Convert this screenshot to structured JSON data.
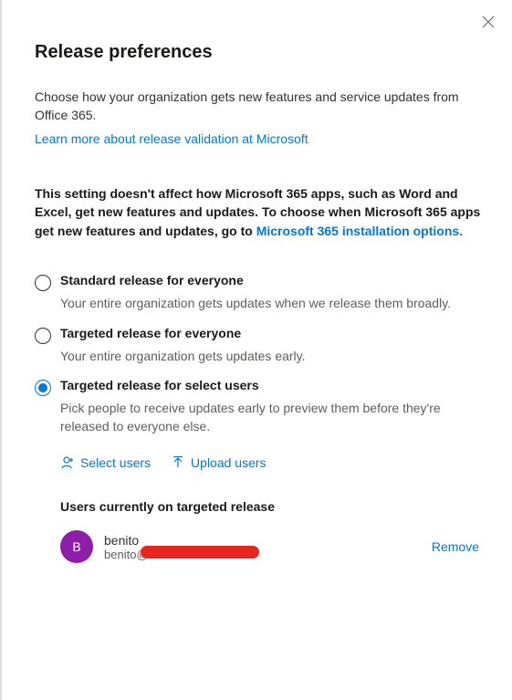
{
  "header": {
    "title": "Release preferences"
  },
  "intro": {
    "text": "Choose how your organization gets new features and service updates from Office 365.",
    "learn_more": "Learn more about release validation at Microsoft"
  },
  "notice": {
    "prefix": "This setting doesn't affect how Microsoft 365 apps, such as Word and Excel, get new features and updates. To choose when Microsoft 365 apps get new features and updates, go to ",
    "link": "Microsoft 365 installation options."
  },
  "options": [
    {
      "label": "Standard release for everyone",
      "desc": "Your entire organization gets updates when we release them broadly.",
      "selected": false
    },
    {
      "label": "Targeted release for everyone",
      "desc": "Your entire organization gets updates early.",
      "selected": false
    },
    {
      "label": "Targeted release for select users",
      "desc": "Pick people to receive updates early to preview them before they're released to everyone else.",
      "selected": true
    }
  ],
  "actions": {
    "select_users": "Select users",
    "upload_users": "Upload users"
  },
  "users_section": {
    "heading": "Users currently on targeted release",
    "users": [
      {
        "initial": "B",
        "name": "benito",
        "email": "benito@",
        "avatar_color": "#8e1da8"
      }
    ],
    "remove_label": "Remove"
  }
}
